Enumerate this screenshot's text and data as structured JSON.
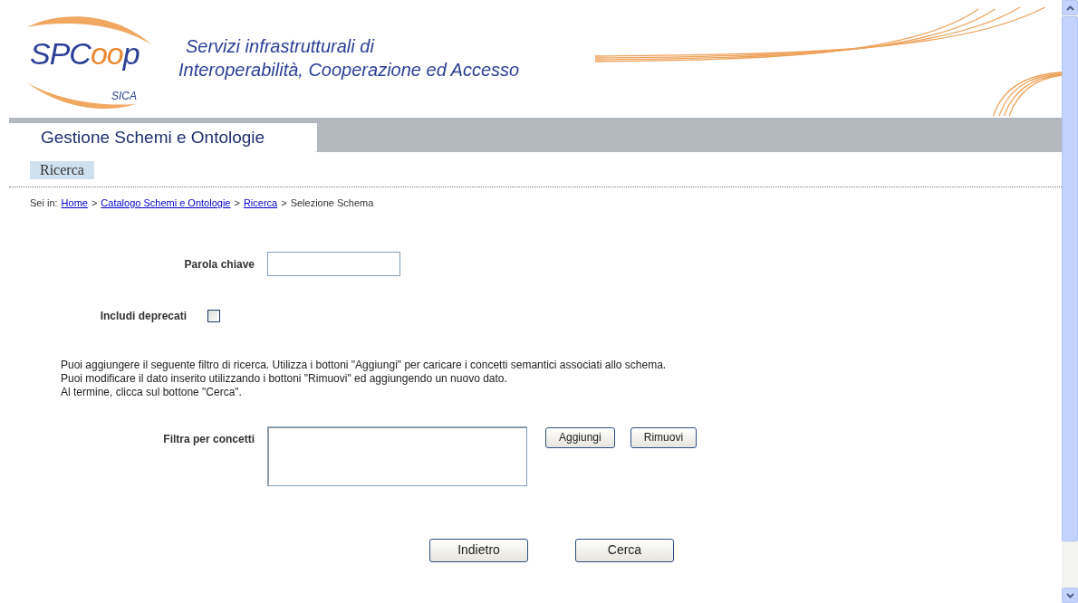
{
  "header": {
    "logo": {
      "parts": [
        {
          "text": "SPC",
          "color": "#2b3f95"
        },
        {
          "text": "oo",
          "color": "#e8892f"
        },
        {
          "text": "p",
          "color": "#2b3f95"
        }
      ],
      "subtitle": "SICA"
    },
    "title_lines": [
      "Servizi infrastrutturali di",
      "Interoperabilità, Cooperazione ed Accesso"
    ]
  },
  "section_tab": {
    "label": "Gestione Schemi e Ontologie"
  },
  "page_label": "Ricerca",
  "breadcrumb": {
    "prefix": "Sei in:",
    "links": [
      "Home",
      "Catalogo Schemi e Ontologie",
      "Ricerca"
    ],
    "current": "Selezione Schema",
    "separator": ">"
  },
  "form": {
    "keyword": {
      "label": "Parola chiave"
    },
    "include_deprecated": {
      "label": "Includi deprecati",
      "checked": false
    },
    "instructions": [
      "Puoi aggiungere il seguente filtro di ricerca. Utilizza i bottoni \"Aggiungi\" per caricare i concetti semantici associati allo schema.",
      "Puoi modificare il dato inserito utilizzando i bottoni \"Rimuovi\" ed aggiungendo un nuovo dato.",
      "Al termine, clicca sul bottone \"Cerca\"."
    ],
    "concepts": {
      "label": "Filtra per concetti",
      "buttons": [
        "Aggiungi",
        "Rimuovi"
      ]
    }
  },
  "actions": [
    "Indietro",
    "Cerca"
  ]
}
